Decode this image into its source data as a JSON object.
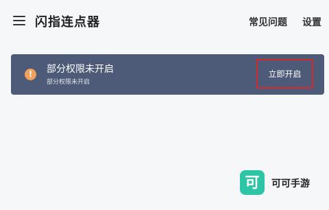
{
  "header": {
    "title": "闪指连点器",
    "faq_label": "常见问题",
    "settings_label": "设置"
  },
  "banner": {
    "icon_glyph": "!",
    "title": "部分权限未开启",
    "subtitle": "部分权限未开启",
    "button_label": "立即开启"
  },
  "watermark": {
    "logo_glyph": "可",
    "text": "可可手游"
  },
  "colors": {
    "page_background": "#f6f7f9",
    "banner_background": "#4d5a78",
    "warning_icon": "#f0a15e",
    "button_highlight_border": "#d42a2a",
    "watermark_logo": "#2ec4a6"
  }
}
